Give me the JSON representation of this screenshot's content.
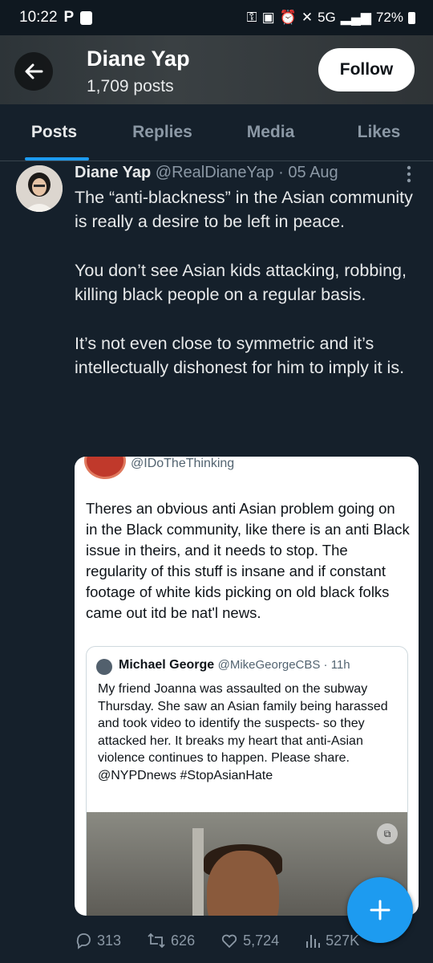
{
  "status_bar": {
    "time": "10:22",
    "left_icons": [
      "p-icon",
      "app-notification-icon"
    ],
    "network": "5G",
    "battery": "72%"
  },
  "header": {
    "name": "Diane Yap",
    "post_count": "1,709 posts",
    "follow_label": "Follow"
  },
  "tabs": [
    {
      "label": "Posts",
      "active": true
    },
    {
      "label": "Replies",
      "active": false
    },
    {
      "label": "Media",
      "active": false
    },
    {
      "label": "Likes",
      "active": false
    }
  ],
  "tweet": {
    "author_name": "Diane Yap",
    "handle_date": "@RealDianeYap · 05 Aug",
    "text": "The “anti-blackness” in the Asian community is really a desire to be left in peace.\n\nYou don’t see Asian kids attacking, robbing, killing black people on a regular basis.\n\nIt’s not even close to symmetric and it’s intellectually dishonest for him to imply it is.",
    "embedded": {
      "handle": "@IDoTheThinking",
      "text": "Theres an obvious anti Asian problem going on in the Black community, like there is an anti Black issue in theirs, and it needs to stop. The regularity of this stuff is insane and if constant footage of white kids picking on old black folks came out itd be nat'l news.",
      "quote": {
        "name": "Michael George",
        "handle_time": "@MikeGeorgeCBS · 11h",
        "text": "My friend Joanna was assaulted on the subway Thursday. She saw an Asian family being harassed and took video to identify the suspects- so they attacked her. It breaks my heart that anti-Asian violence continues to happen. Please share. @NYPDnews #StopAsianHate"
      }
    },
    "stats": {
      "replies": "313",
      "reposts": "626",
      "likes": "5,724",
      "views": "527K"
    }
  },
  "colors": {
    "background": "#15202b",
    "accent": "#1d9bf0",
    "secondary_text": "#8b98a5"
  }
}
